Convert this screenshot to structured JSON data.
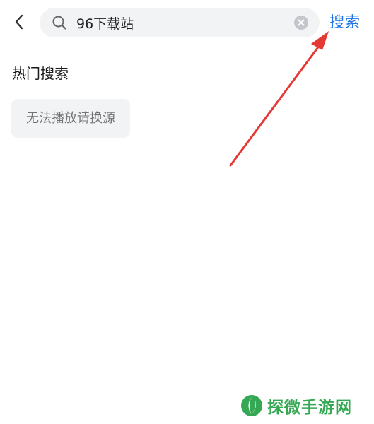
{
  "header": {
    "back_icon": "chevron-left-icon",
    "search": {
      "value": "96下载站",
      "placeholder": "",
      "search_icon": "search-icon",
      "clear_icon": "clear-circle-icon"
    },
    "search_button_label": "搜索"
  },
  "hot_search": {
    "title": "热门搜索",
    "tags": [
      "无法播放请换源"
    ]
  },
  "annotation": {
    "type": "red-arrow",
    "points_to": "search-button",
    "color": "#e53935"
  },
  "watermark": {
    "text": "探微手游网",
    "logo_icon": "leaf-logo-icon",
    "color": "#34a853"
  },
  "colors": {
    "accent": "#1a73e8",
    "input_bg": "#f2f3f5",
    "tag_bg": "#f2f3f5",
    "arrow": "#e53935"
  }
}
